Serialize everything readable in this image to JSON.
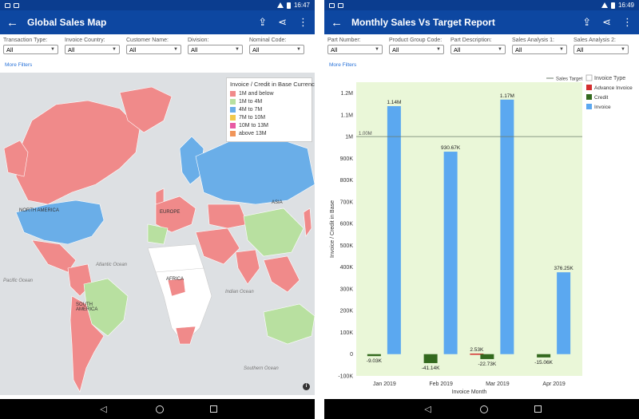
{
  "left": {
    "status": {
      "time": "16:47"
    },
    "appbar": {
      "title": "Global Sales Map"
    },
    "filters": [
      {
        "label": "Transaction Type:",
        "value": "All"
      },
      {
        "label": "Invoice Country:",
        "value": "All"
      },
      {
        "label": "Customer Name:",
        "value": "All"
      },
      {
        "label": "Division:",
        "value": "All"
      },
      {
        "label": "Nominal Code:",
        "value": "All"
      }
    ],
    "more_filters": "More Filters",
    "legend": {
      "title": "Invoice / Credit in Base Currency",
      "items": [
        {
          "label": "1M and below",
          "color": "#f08a8a"
        },
        {
          "label": "1M to 4M",
          "color": "#b8e0a0"
        },
        {
          "label": "4M to 7M",
          "color": "#6aaee8"
        },
        {
          "label": "7M to 10M",
          "color": "#f2c94c"
        },
        {
          "label": "10M to 13M",
          "color": "#e85aa3"
        },
        {
          "label": "above 13M",
          "color": "#f0955a"
        }
      ]
    },
    "map_labels": {
      "north_america": "NORTH AMERICA",
      "south_america": "SOUTH AMERICA",
      "europe": "EUROPE",
      "africa": "AFRICA",
      "asia": "ASIA",
      "atlantic": "Atlantic Ocean",
      "pacific": "Pacific Ocean",
      "indian": "Indian Ocean",
      "southern": "Southern Ocean"
    }
  },
  "right": {
    "status": {
      "time": "16:49"
    },
    "appbar": {
      "title": "Monthly Sales Vs Target Report"
    },
    "filters": [
      {
        "label": "Part Number:",
        "value": "All"
      },
      {
        "label": "Product Group Code:",
        "value": "All"
      },
      {
        "label": "Part Description:",
        "value": "All"
      },
      {
        "label": "Sales Analysis 1:",
        "value": "All"
      },
      {
        "label": "Sales Analysis 2:",
        "value": "All"
      }
    ],
    "more_filters": "More Filters"
  },
  "chart_data": {
    "type": "bar",
    "categories": [
      "Jan 2019",
      "Feb 2019",
      "Mar 2019",
      "Apr 2019"
    ],
    "series": [
      {
        "name": "Advance Invoice",
        "color": "#d32f2f",
        "values": [
          0,
          0,
          2530,
          0
        ],
        "labels": [
          "",
          "",
          "2.53K",
          ""
        ]
      },
      {
        "name": "Credit",
        "color": "#33691e",
        "values": [
          -9030,
          -41140,
          -22730,
          -15060
        ],
        "labels": [
          "-9.03K",
          "-41.14K",
          "-22.73K",
          "-15.06K"
        ]
      },
      {
        "name": "Invoice",
        "color": "#5ba8f0",
        "values": [
          1140000,
          930670,
          1170000,
          376250
        ],
        "labels": [
          "1.14M",
          "930.67K",
          "1.17M",
          "376.25K"
        ]
      }
    ],
    "target": {
      "name": "Sales Target",
      "value": 1000000,
      "label": "1.00M"
    },
    "legend_title": "Invoice Type",
    "xlabel": "Invoice Month",
    "ylabel": "Invoice / Credit in Base",
    "ylim": [
      -100000,
      1250000
    ],
    "yticks": [
      -100000,
      0,
      100000,
      200000,
      300000,
      400000,
      500000,
      600000,
      700000,
      800000,
      900000,
      1000000,
      1100000,
      1200000
    ],
    "ytick_labels": [
      "-100K",
      "0",
      "100K",
      "200K",
      "300K",
      "400K",
      "500K",
      "600K",
      "700K",
      "800K",
      "900K",
      "1M",
      "1.1M",
      "1.2M"
    ],
    "plot_background": "#eaf7d8",
    "legend_position": "right"
  }
}
